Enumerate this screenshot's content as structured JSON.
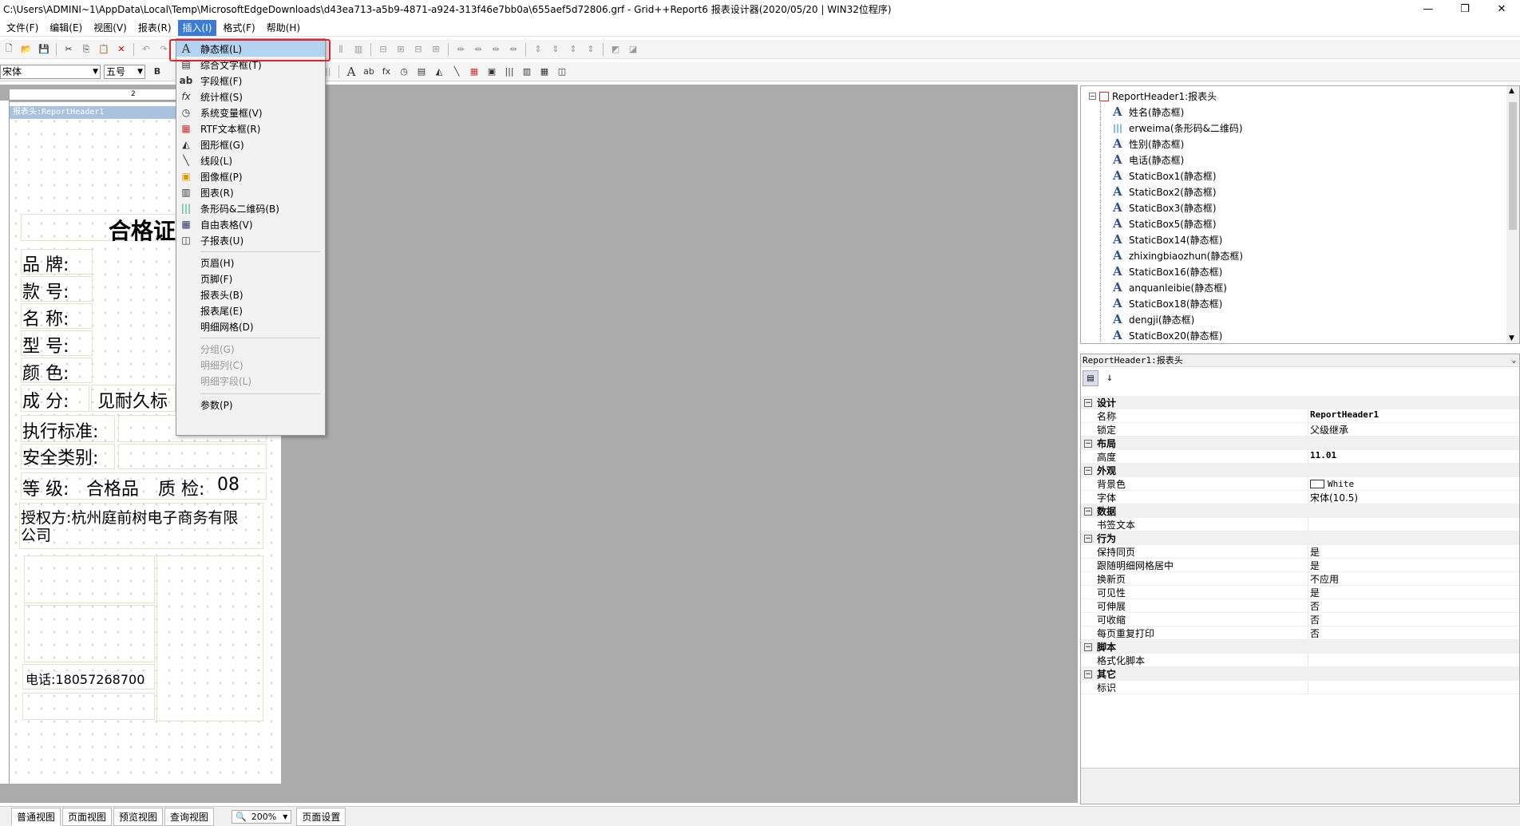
{
  "window": {
    "title": "C:\\Users\\ADMINI~1\\AppData\\Local\\Temp\\MicrosoftEdgeDownloads\\d43ea713-a5b9-4871-a924-313f46e7bb0a\\655aef5d72806.grf - Grid++Report6 报表设计器(2020/05/20 | WIN32位程序)",
    "minimize": "—",
    "restore": "❐",
    "close": "✕"
  },
  "menubar": {
    "items": [
      "文件(F)",
      "编辑(E)",
      "视图(V)",
      "报表(R)",
      "插入(I)",
      "格式(F)",
      "帮助(H)"
    ]
  },
  "toolbar2": {
    "font": "宋体",
    "size": "五号",
    "bold": "B"
  },
  "insert_menu": {
    "items": [
      {
        "icon": "A",
        "label": "静态框(L)"
      },
      {
        "icon": "▤",
        "label": "综合文字框(T)"
      },
      {
        "icon": "ab",
        "label": "字段框(F)"
      },
      {
        "icon": "fx",
        "label": "统计框(S)"
      },
      {
        "icon": "◷",
        "label": "系统变量框(V)"
      },
      {
        "icon": "▦",
        "label": "RTF文本框(R)"
      },
      {
        "icon": "◭",
        "label": "图形框(G)"
      },
      {
        "icon": "╲",
        "label": "线段(L)"
      },
      {
        "icon": "▣",
        "label": "图像框(P)"
      },
      {
        "icon": "▥",
        "label": "图表(R)"
      },
      {
        "icon": "|||",
        "label": "条形码&二维码(B)"
      },
      {
        "icon": "▦",
        "label": "自由表格(V)"
      },
      {
        "icon": "◫",
        "label": "子报表(U)"
      },
      {
        "icon": "",
        "label": "页眉(H)"
      },
      {
        "icon": "",
        "label": "页脚(F)"
      },
      {
        "icon": "",
        "label": "报表头(B)"
      },
      {
        "icon": "",
        "label": "报表尾(E)"
      },
      {
        "icon": "",
        "label": "明细网格(D)"
      },
      {
        "icon": "",
        "label": "分组(G)"
      },
      {
        "icon": "",
        "label": "明细列(C)"
      },
      {
        "icon": "",
        "label": "明细字段(L)"
      },
      {
        "icon": "",
        "label": "参数(P)"
      }
    ]
  },
  "design": {
    "band_header": "报表头:ReportHeader1",
    "ruler_mark": "2",
    "title": "合格证",
    "labels": {
      "brand": "品  牌:",
      "style": "款  号:",
      "name": "名  称:",
      "model": "型  号:",
      "color": "颜  色:",
      "composition": "成  分:",
      "composition_value": "见耐久标",
      "standard": "执行标准:",
      "safety": "安全类别:",
      "grade": "等  级:",
      "grade_value": "合格品",
      "qc": "质  检:",
      "qc_value": "08",
      "auth1": "授权方:杭州庭前树电子商务有限",
      "auth2": "公司",
      "phone": "电话:18057268700"
    }
  },
  "tree": {
    "root": "ReportHeader1:报表头",
    "items": [
      "姓名(静态框)",
      "erweima(条形码&二维码)",
      "性别(静态框)",
      "电话(静态框)",
      "StaticBox1(静态框)",
      "StaticBox2(静态框)",
      "StaticBox3(静态框)",
      "StaticBox5(静态框)",
      "StaticBox14(静态框)",
      "zhixingbiaozhun(静态框)",
      "StaticBox16(静态框)",
      "anquanleibie(静态框)",
      "StaticBox18(静态框)",
      "dengji(静态框)",
      "StaticBox20(静态框)"
    ]
  },
  "props": {
    "header": "ReportHeader1:报表头",
    "rows": [
      {
        "cat": "设计"
      },
      {
        "name": "名称",
        "value": "ReportHeader1"
      },
      {
        "name": "锁定",
        "value": "父级继承"
      },
      {
        "cat": "布局"
      },
      {
        "name": "高度",
        "value": "11.01"
      },
      {
        "cat": "外观"
      },
      {
        "name": "背景色",
        "value": "White"
      },
      {
        "name": "字体",
        "value": "宋体(10.5)"
      },
      {
        "cat": "数据"
      },
      {
        "name": "书签文本",
        "value": ""
      },
      {
        "cat": "行为"
      },
      {
        "name": "保持同页",
        "value": "是"
      },
      {
        "name": "跟随明细网格居中",
        "value": "是"
      },
      {
        "name": "换新页",
        "value": "不应用"
      },
      {
        "name": "可见性",
        "value": "是"
      },
      {
        "name": "可伸展",
        "value": "否"
      },
      {
        "name": "可收缩",
        "value": "否"
      },
      {
        "name": "每页重复打印",
        "value": "否"
      },
      {
        "cat": "脚本"
      },
      {
        "name": "格式化脚本",
        "value": ""
      },
      {
        "cat": "其它"
      },
      {
        "name": "标识",
        "value": ""
      }
    ]
  },
  "bottom": {
    "tabs": [
      "普通视图",
      "页面视图",
      "预览视图",
      "查询视图"
    ],
    "zoom": "200%",
    "page_setup": "页面设置"
  },
  "colors": {
    "menu_active": "#3a7bd5",
    "highlight": "#b4d3f0",
    "callout": "#e8202a"
  }
}
